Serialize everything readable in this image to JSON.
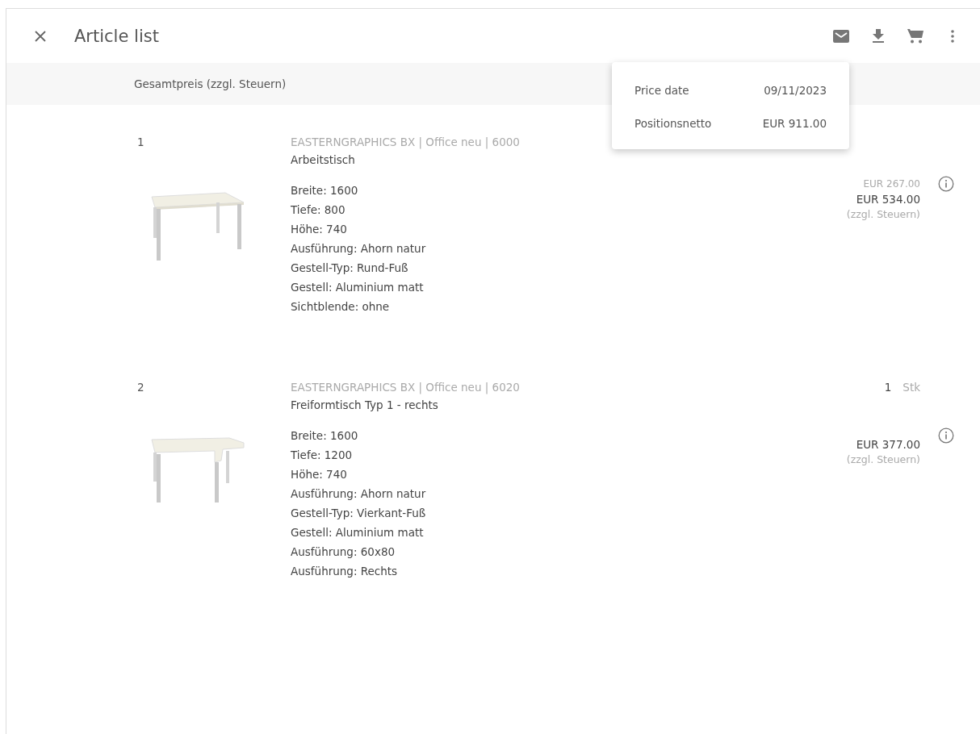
{
  "header": {
    "title": "Article list"
  },
  "column_header": "Gesamtpreis (zzgl. Steuern)",
  "items": [
    {
      "number": "1",
      "source": "EASTERNGRAPHICS BX | Office neu | 6000",
      "name": "Arbeitstisch",
      "kind": "rectangular",
      "attributes": [
        "Breite: 1600",
        "Tiefe: 800",
        "Höhe: 740",
        "Ausführung: Ahorn natur",
        "Gestell-Typ: Rund-Fuß",
        "Gestell: Aluminium matt",
        "Sichtblende: ohne"
      ],
      "unit_price": "EUR 267.00",
      "total": "EUR 534.00",
      "tax_note": "(zzgl. Steuern)"
    },
    {
      "number": "2",
      "source": "EASTERNGRAPHICS BX | Office neu | 6020",
      "name": "Freiformtisch Typ 1 - rechts",
      "kind": "corner",
      "quantity": "1",
      "unit": "Stk",
      "attributes": [
        "Breite: 1600",
        "Tiefe: 1200",
        "Höhe: 740",
        "Ausführung: Ahorn natur",
        "Gestell-Typ: Vierkant-Fuß",
        "Gestell: Aluminium matt",
        "Ausführung: 60x80",
        "Ausführung: Rechts"
      ],
      "total": "EUR 377.00",
      "tax_note": "(zzgl. Steuern)"
    }
  ],
  "popup": {
    "rows": [
      {
        "label": "Price date",
        "value": "09/11/2023"
      },
      {
        "label": "Positionsnetto",
        "value": "EUR 911.00"
      }
    ]
  }
}
